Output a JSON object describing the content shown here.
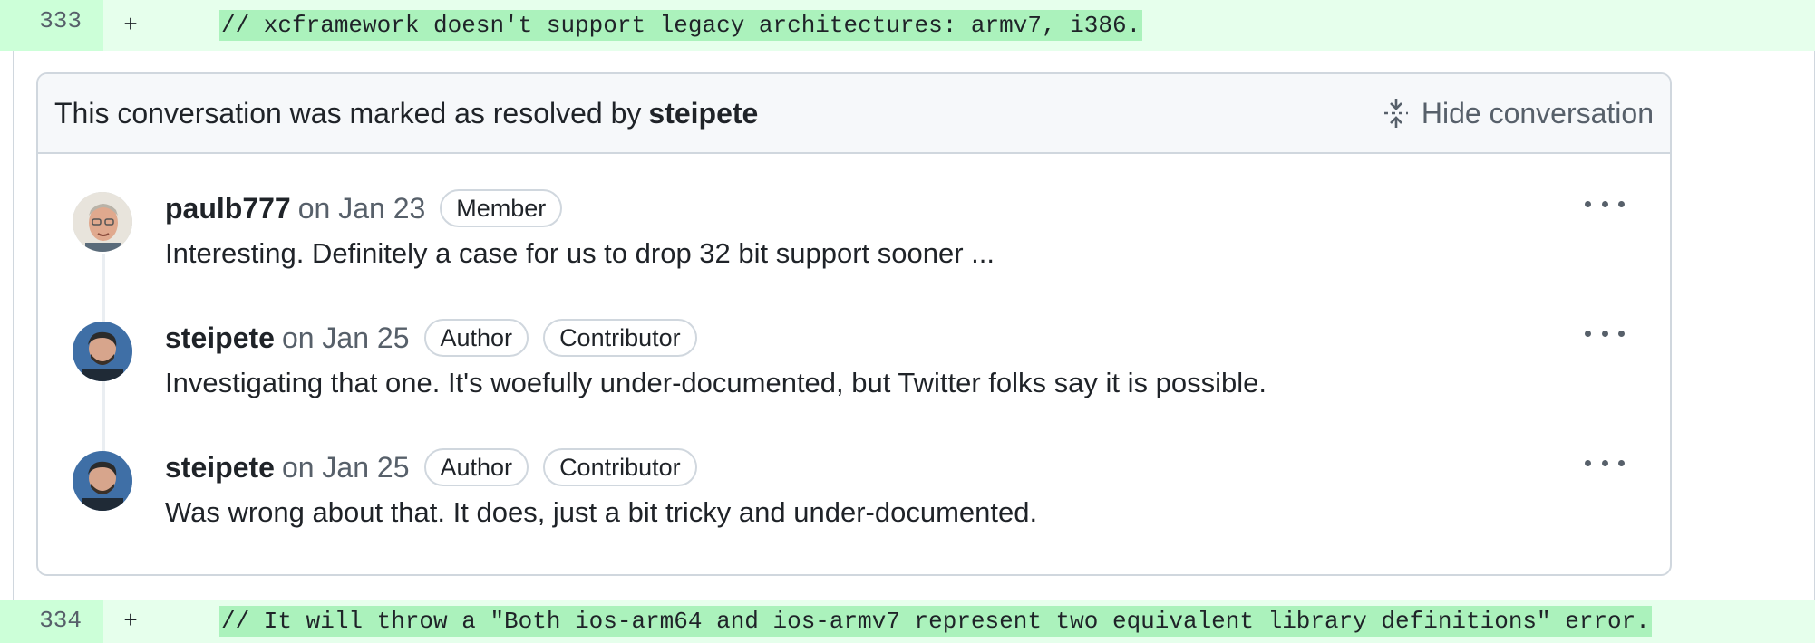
{
  "diff": {
    "line_top": {
      "number": "333",
      "marker": "+",
      "code": "// xcframework doesn't support legacy architectures: armv7, i386."
    },
    "line_bottom": {
      "number": "334",
      "marker": "+",
      "code": "// It will throw a \"Both ios-arm64 and ios-armv7 represent two equivalent library definitions\" error."
    }
  },
  "thread": {
    "resolved_prefix": "This conversation was marked as resolved by",
    "resolved_by": "steipete",
    "hide_label": "Hide conversation",
    "comments": [
      {
        "author": "paulb777",
        "date": "on Jan 23",
        "badges": [
          "Member"
        ],
        "body": "Interesting. Definitely a case for us to drop 32 bit support sooner ..."
      },
      {
        "author": "steipete",
        "date": "on Jan 25",
        "badges": [
          "Author",
          "Contributor"
        ],
        "body": "Investigating that one. It's woefully under-documented, but Twitter folks say it is possible."
      },
      {
        "author": "steipete",
        "date": "on Jan 25",
        "badges": [
          "Author",
          "Contributor"
        ],
        "body": "Was wrong about that. It does, just a bit tricky and under-documented."
      }
    ]
  },
  "colors": {
    "added_line_bg": "#e6ffec",
    "added_num_bg": "#ccffd8",
    "added_highlight": "#abf2bc",
    "border": "#d0d7de",
    "muted_text": "#57606a"
  },
  "icons": {
    "hide": "fold-icon",
    "menu": "kebab-horizontal-icon"
  }
}
